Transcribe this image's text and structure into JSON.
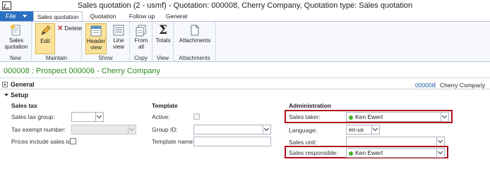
{
  "window": {
    "title": "Sales quotation (2 - usmf) - Quotation: 000008, Cherry Company, Quotation type: Sales quotation"
  },
  "ribbon": {
    "file_label": "File",
    "tabs": [
      {
        "label": "Sales quotation",
        "active": true
      },
      {
        "label": "Quotation",
        "active": false
      },
      {
        "label": "Follow up",
        "active": false
      },
      {
        "label": "General",
        "active": false
      }
    ],
    "groups": {
      "new": {
        "label": "New",
        "sales_quotation_line1": "Sales",
        "sales_quotation_line2": "quotation"
      },
      "maintain": {
        "label": "Maintain",
        "edit": "Edit",
        "delete": "Delete"
      },
      "show": {
        "label": "Show",
        "header_view_line1": "Header",
        "header_view_line2": "view",
        "line_view_line1": "Line",
        "line_view_line2": "view"
      },
      "copy": {
        "label": "Copy",
        "from_all_line1": "From",
        "from_all_line2": "all"
      },
      "view": {
        "label": "View",
        "totals": "Totals"
      },
      "attachments": {
        "label": "Attachments",
        "attachments": "Attachments"
      }
    }
  },
  "record": {
    "heading": "000008 : Prospect 000006 - Cherry Company"
  },
  "general": {
    "label": "General",
    "summary_link": "000008",
    "summary_text": "Cherry Company"
  },
  "setup": {
    "label": "Setup",
    "sales_tax": {
      "heading": "Sales tax",
      "sales_tax_group_label": "Sales tax group:",
      "sales_tax_group_value": "",
      "tax_exempt_label": "Tax exempt number:",
      "tax_exempt_value": "",
      "prices_include_tax_label": "Prices include sales tax:",
      "prices_include_tax_checked": false
    },
    "template": {
      "heading": "Template",
      "active_label": "Active:",
      "active_checked": false,
      "group_id_label": "Group ID:",
      "group_id_value": "",
      "template_name_label": "Template name:",
      "template_name_value": ""
    },
    "administration": {
      "heading": "Administration",
      "sales_taker_label": "Sales taker:",
      "sales_taker_value": "Ken Ewert",
      "language_label": "Language:",
      "language_value": "en-us",
      "sales_unit_label": "Sales unit:",
      "sales_unit_value": "",
      "sales_responsible_label": "Sales responsible:",
      "sales_responsible_value": "Ken Ewert"
    }
  },
  "colors": {
    "file_tab": "#2b6fc1",
    "record_heading": "#2e8b1f",
    "highlight": "#b0101c",
    "selected_button": "#fbe29a",
    "worker_status_dot": "#43b02a"
  }
}
